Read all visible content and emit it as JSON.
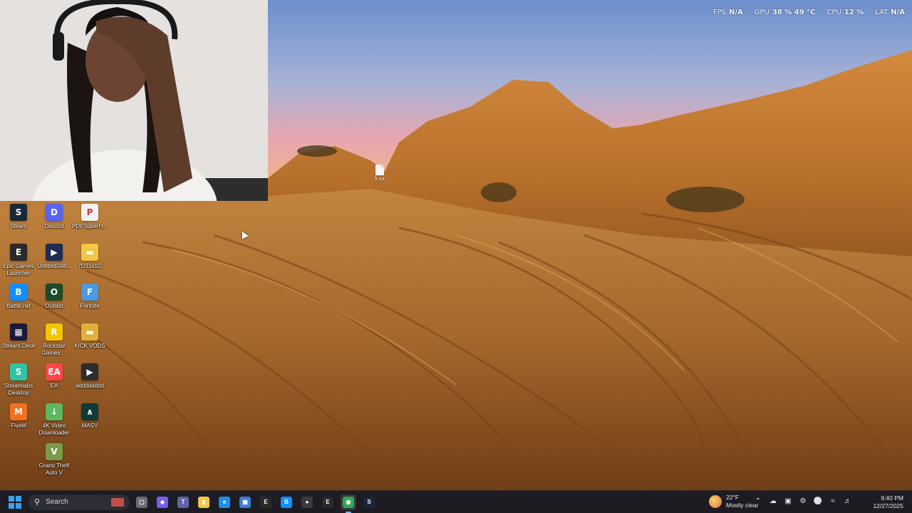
{
  "hud": {
    "fps_label": "FPS",
    "fps_value": "N/A",
    "gpu_label": "GPU",
    "gpu_value": "38 %  49 °C",
    "cpu_label": "CPU",
    "cpu_value": "12 %",
    "lat_label": "LAT",
    "lat_value": "N/A"
  },
  "desktop": {
    "file_icon": "fr.rpt",
    "icons": [
      {
        "label": "Steam",
        "icon": "steam-icon",
        "color": "#1b2838"
      },
      {
        "label": "Discord",
        "icon": "discord-icon",
        "color": "#5865f2"
      },
      {
        "label": "PDFSuperH...",
        "icon": "pdf-icon",
        "color": "#f2f2f2"
      },
      {
        "label": "Epic Games Launcher",
        "icon": "epic-games-icon",
        "color": "#2a2a2a"
      },
      {
        "label": "Untitled348...",
        "icon": "video-file-icon",
        "color": "#1e2c55"
      },
      {
        "label": "7D31v1C",
        "icon": "folder-icon",
        "color": "#f2c744"
      },
      {
        "label": "Battle.net",
        "icon": "battlenet-icon",
        "color": "#148eff"
      },
      {
        "label": "Outlast",
        "icon": "outlast-icon",
        "color": "#1f4a2a"
      },
      {
        "label": "Fortnite",
        "icon": "fortnite-icon",
        "color": "#4a9ae0"
      },
      {
        "label": "Stream Deck",
        "icon": "stream-deck-icon",
        "color": "#1a1a3a"
      },
      {
        "label": "Rockstar Games ...",
        "icon": "rockstar-icon",
        "color": "#f5c400"
      },
      {
        "label": "KICK VODS",
        "icon": "folder-icon",
        "color": "#e0b13a"
      },
      {
        "label": "Streamlabs Desktop",
        "icon": "streamlabs-icon",
        "color": "#31c3a2"
      },
      {
        "label": "EA",
        "icon": "ea-icon",
        "color": "#ff4747"
      },
      {
        "label": "adddddddd",
        "icon": "video-file-icon",
        "color": "#2c2c2c"
      },
      {
        "label": "FiveM",
        "icon": "fivem-icon",
        "color": "#f37021"
      },
      {
        "label": "4K Video Downloader",
        "icon": "downloader-icon",
        "color": "#5cb85c"
      },
      {
        "label": "MASV",
        "icon": "masv-icon",
        "color": "#0f3b3b"
      },
      {
        "label": "Grand Theft Auto V",
        "icon": "gta-icon",
        "color": "#7a9c4a"
      }
    ]
  },
  "taskbar": {
    "search_placeholder": "Search",
    "apps": [
      {
        "name": "task-view-icon",
        "color": "#6c6c78",
        "glyph": "▢"
      },
      {
        "name": "copilot-icon",
        "color": "#7b5cf2",
        "glyph": "◆"
      },
      {
        "name": "teams-icon",
        "color": "#6264a7",
        "glyph": "T"
      },
      {
        "name": "file-explorer-icon",
        "color": "#f2c744",
        "glyph": "▮"
      },
      {
        "name": "edge-icon",
        "color": "#1f8ee8",
        "glyph": "e"
      },
      {
        "name": "store-icon",
        "color": "#3a7fd4",
        "glyph": "▦"
      },
      {
        "name": "epic-games-icon",
        "color": "#2a2a2a",
        "glyph": "E"
      },
      {
        "name": "battlenet-icon",
        "color": "#148eff",
        "glyph": "B"
      },
      {
        "name": "obs-icon",
        "color": "#3b3b3b",
        "glyph": "●"
      },
      {
        "name": "epic-games-icon-2",
        "color": "#2a2a2a",
        "glyph": "E"
      },
      {
        "name": "chrome-icon",
        "color": "#34a853",
        "glyph": "◉",
        "active": true
      },
      {
        "name": "steam-icon",
        "color": "#1b2838",
        "glyph": "S"
      }
    ],
    "weather": {
      "temp": "22°F",
      "condition": "Mostly clear"
    },
    "clock": {
      "time": "9:40 PM",
      "date": "12/27/2025"
    }
  }
}
